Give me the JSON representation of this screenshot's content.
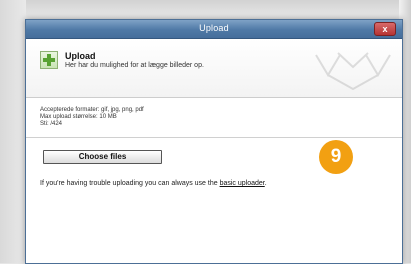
{
  "window": {
    "title": "Upload",
    "close_label": "x"
  },
  "header": {
    "icon": "plus-icon",
    "title": "Upload",
    "subtitle": "Her har du mulighed for at lægge billeder op."
  },
  "info": {
    "formats": "Accepterede formater: gif, jpg, png, pdf",
    "max_size": "Max upload størrelse: 10 MB",
    "path": "Sti: /424"
  },
  "actions": {
    "choose_files_label": "Choose files"
  },
  "help": {
    "text_before": "If you're having trouble uploading you can always use the ",
    "link_text": "basic uploader",
    "text_after": "."
  },
  "badge": {
    "number": "9",
    "color": "#f2a012"
  },
  "colors": {
    "titlebar": "#4f79a6",
    "plus": "#58a232",
    "badge": "#f2a012"
  }
}
